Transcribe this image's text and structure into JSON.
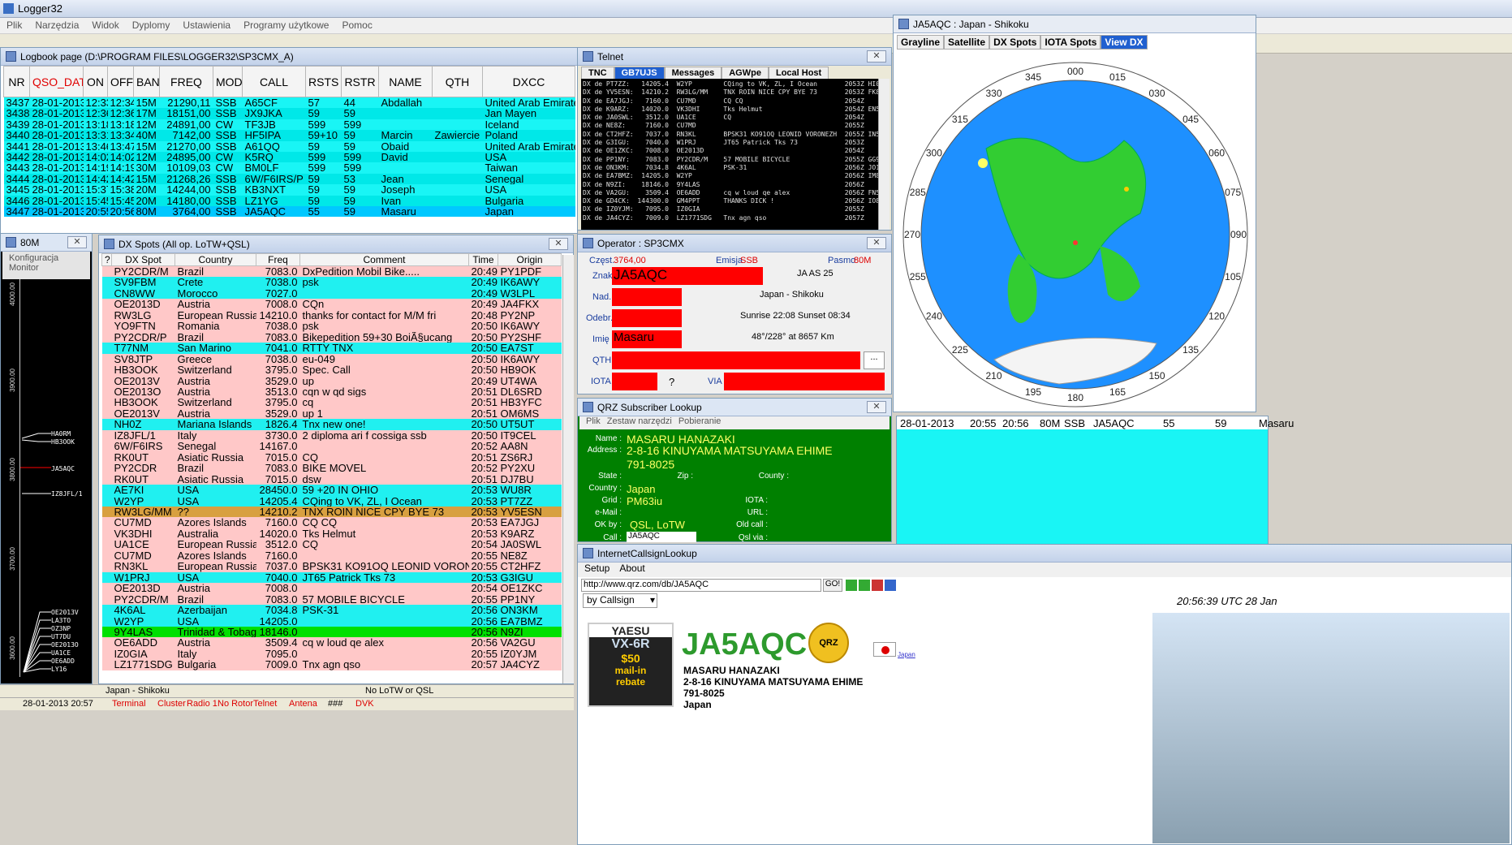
{
  "app": {
    "title": "Logger32"
  },
  "menu": [
    "Plik",
    "Narzędzia",
    "Widok",
    "Dyplomy",
    "Ustawienia",
    "Programy użytkowe",
    "Pomoc"
  ],
  "logbook": {
    "title": "Logbook page (D:\\PROGRAM FILES\\LOGGER32\\SP3CMX_A)",
    "columns": [
      "NR",
      "QSO_DATE",
      "ON",
      "OFF",
      "BAND",
      "FREQ",
      "MODE",
      "CALL",
      "RSTS",
      "RSTR",
      "NAME",
      "QTH",
      "DXCC"
    ],
    "rows": [
      [
        "3437",
        "28-01-2013",
        "12:33",
        "12:34",
        "15M",
        "21290,11",
        "SSB",
        "A65CF",
        "57",
        "44",
        "Abdallah",
        "",
        "United Arab Emirates"
      ],
      [
        "3438",
        "28-01-2013",
        "12:36",
        "12:36",
        "17M",
        "18151,00",
        "SSB",
        "JX9JKA",
        "59",
        "59",
        "",
        "",
        "Jan Mayen"
      ],
      [
        "3439",
        "28-01-2013",
        "13:18",
        "13:18",
        "12M",
        "24891,00",
        "CW",
        "TF3JB",
        "599",
        "599",
        "",
        "",
        "Iceland"
      ],
      [
        "3440",
        "28-01-2013",
        "13:31",
        "13:34",
        "40M",
        "7142,00",
        "SSB",
        "HF5IPA",
        "59+10",
        "59",
        "Marcin",
        "Zawiercie",
        "Poland"
      ],
      [
        "3441",
        "28-01-2013",
        "13:46",
        "13:47",
        "15M",
        "21270,00",
        "SSB",
        "A61QQ",
        "59",
        "59",
        "Obaid",
        "",
        "United Arab Emirates"
      ],
      [
        "3442",
        "28-01-2013",
        "14:02",
        "14:02",
        "12M",
        "24895,00",
        "CW",
        "K5RQ",
        "599",
        "599",
        "David",
        "",
        "USA"
      ],
      [
        "3443",
        "28-01-2013",
        "14:19",
        "14:19",
        "30M",
        "10109,03",
        "CW",
        "BM0LF",
        "599",
        "599",
        "",
        "",
        "Taiwan"
      ],
      [
        "3444",
        "28-01-2013",
        "14:42",
        "14:42",
        "15M",
        "21268,26",
        "SSB",
        "6W/F6IRS/P",
        "59",
        "53",
        "Jean",
        "",
        "Senegal"
      ],
      [
        "3445",
        "28-01-2013",
        "15:37",
        "15:38",
        "20M",
        "14244,00",
        "SSB",
        "KB3NXT",
        "59",
        "59",
        "Joseph",
        "",
        "USA"
      ],
      [
        "3446",
        "28-01-2013",
        "15:45",
        "15:45",
        "20M",
        "14180,00",
        "SSB",
        "LZ1YG",
        "59",
        "59",
        "Ivan",
        "",
        "Bulgaria"
      ],
      [
        "3447",
        "28-01-2013",
        "20:55",
        "20:56",
        "80M",
        "3764,00",
        "SSB",
        "JA5AQC",
        "55",
        "59",
        "Masaru",
        "",
        "Japan"
      ]
    ]
  },
  "bandmap": {
    "title": "80M",
    "menu": [
      "Konfiguracja",
      "Monitor"
    ],
    "ticks": [
      "4000.00",
      "3900.00",
      "3800.00",
      "3700.00",
      "3600.00"
    ],
    "labels": [
      "HA0RM",
      "HB3OOK",
      "JA5AQC",
      "IZ8JFL/1",
      "OE2013V",
      "LA3TO",
      "OZ3NP",
      "UT7DU",
      "OE2013O",
      "UA1CE",
      "OE6ADD",
      "LY16"
    ]
  },
  "dxspots": {
    "title": "DX Spots (All op. LoTW+QSL)",
    "columns": [
      "?",
      "DX Spot",
      "Country",
      "Freq",
      "Comment",
      "Time",
      "Origin"
    ],
    "rows": [
      {
        "c": "pk",
        "v": [
          "",
          "PY2CDR/M",
          "Brazil",
          "7083.0",
          "DxPedition Mobil Bike.....",
          "20:49",
          "PY1PDF"
        ]
      },
      {
        "c": "cy",
        "v": [
          "",
          "SV9FBM",
          "Crete",
          "7038.0",
          "psk",
          "20:49",
          "IK6AWY"
        ]
      },
      {
        "c": "cy",
        "v": [
          "",
          "CN8WW",
          "Morocco",
          "7027.0",
          "",
          "20:49",
          "W3LPL"
        ]
      },
      {
        "c": "pk",
        "v": [
          "",
          "OE2013D",
          "Austria",
          "7008.0",
          "CQn",
          "20:49",
          "JA4FKX"
        ]
      },
      {
        "c": "pk",
        "v": [
          "",
          "RW3LG",
          "European Russia",
          "14210.0",
          "thanks for contact for M/M fri",
          "20:48",
          "PY2NP"
        ]
      },
      {
        "c": "pk",
        "v": [
          "",
          "YO9FTN",
          "Romania",
          "7038.0",
          "psk",
          "20:50",
          "IK6AWY"
        ]
      },
      {
        "c": "pk",
        "v": [
          "",
          "PY2CDR/P",
          "Brazil",
          "7083.0",
          "Bikepedition 59+30 BoiÃ§ucang",
          "20:50",
          "PY2SHF"
        ]
      },
      {
        "c": "cy",
        "v": [
          "",
          "T77NM",
          "San Marino",
          "7041.0",
          "RTTY TNX",
          "20:50",
          "EA7ST"
        ]
      },
      {
        "c": "pk",
        "v": [
          "",
          "SV8JTP",
          "Greece",
          "7038.0",
          "eu-049",
          "20:50",
          "IK6AWY"
        ]
      },
      {
        "c": "pk",
        "v": [
          "",
          "HB3OOK",
          "Switzerland",
          "3795.0",
          "Spec. Call",
          "20:50",
          "HB9OK"
        ]
      },
      {
        "c": "pk",
        "v": [
          "",
          "OE2013V",
          "Austria",
          "3529.0",
          "up",
          "20:49",
          "UT4WA"
        ]
      },
      {
        "c": "pk",
        "v": [
          "",
          "OE2013O",
          "Austria",
          "3513.0",
          "cqn w qd sigs",
          "20:51",
          "DL6SRD"
        ]
      },
      {
        "c": "pk",
        "v": [
          "",
          "HB3OOK",
          "Switzerland",
          "3795.0",
          "cq",
          "20:51",
          "HB3YFC"
        ]
      },
      {
        "c": "pk",
        "v": [
          "",
          "OE2013V",
          "Austria",
          "3529.0",
          "up 1",
          "20:51",
          "OM6MS"
        ]
      },
      {
        "c": "cy",
        "v": [
          "",
          "NH0Z",
          "Mariana Islands",
          "1826.4",
          "Tnx new one!",
          "20:50",
          "UT5UT"
        ]
      },
      {
        "c": "pk",
        "v": [
          "",
          "IZ8JFL/1",
          "Italy",
          "3730.0",
          "2 diploma ari f cossiga ssb",
          "20:50",
          "IT9CEL"
        ]
      },
      {
        "c": "pk",
        "v": [
          "",
          "6W/F6IRS",
          "Senegal",
          "14167.0",
          "",
          "20:52",
          "AA8N"
        ]
      },
      {
        "c": "pk",
        "v": [
          "",
          "RK0UT",
          "Asiatic Russia",
          "7015.0",
          "CQ",
          "20:51",
          "ZS6RJ"
        ]
      },
      {
        "c": "pk",
        "v": [
          "",
          "PY2CDR",
          "Brazil",
          "7083.0",
          "BIKE MOVEL",
          "20:52",
          "PY2XU"
        ]
      },
      {
        "c": "pk",
        "v": [
          "",
          "RK0UT",
          "Asiatic Russia",
          "7015.0",
          "dsw",
          "20:51",
          "DJ7BU"
        ]
      },
      {
        "c": "cy",
        "v": [
          "",
          "AE7KI",
          "USA",
          "28450.0",
          "59 +20 IN OHIO",
          "20:53",
          "WU8R"
        ]
      },
      {
        "c": "cy",
        "v": [
          "",
          "W2YP",
          "USA",
          "14205.4",
          "CQing to VK, ZL, I Ocean",
          "20:53",
          "PT7ZZ"
        ]
      },
      {
        "c": "or",
        "v": [
          "",
          "RW3LG/MM",
          "??",
          "14210.2",
          "TNX ROIN NICE CPY BYE 73",
          "20:53",
          "YV5ESN"
        ]
      },
      {
        "c": "pk",
        "v": [
          "",
          "CU7MD",
          "Azores Islands",
          "7160.0",
          "CQ CQ",
          "20:53",
          "EA7JGJ"
        ]
      },
      {
        "c": "pk",
        "v": [
          "",
          "VK3DHI",
          "Australia",
          "14020.0",
          "Tks Helmut",
          "20:53",
          "K9ARZ"
        ]
      },
      {
        "c": "pk",
        "v": [
          "",
          "UA1CE",
          "European Russia",
          "3512.0",
          "CQ",
          "20:54",
          "JA0SWL"
        ]
      },
      {
        "c": "pk",
        "v": [
          "",
          "CU7MD",
          "Azores Islands",
          "7160.0",
          "",
          "20:55",
          "NE8Z"
        ]
      },
      {
        "c": "pk",
        "v": [
          "",
          "RN3KL",
          "European Russia",
          "7037.0",
          "BPSK31 KO91OQ LEONID VORONEZH",
          "20:55",
          "CT2HFZ"
        ]
      },
      {
        "c": "cy",
        "v": [
          "",
          "W1PRJ",
          "USA",
          "7040.0",
          "JT65 Patrick Tks 73",
          "20:53",
          "G3IGU"
        ]
      },
      {
        "c": "pk",
        "v": [
          "",
          "OE2013D",
          "Austria",
          "7008.0",
          "",
          "20:54",
          "OE1ZKC"
        ]
      },
      {
        "c": "pk",
        "v": [
          "",
          "PY2CDR/M",
          "Brazil",
          "7083.0",
          "57 MOBILE BICYCLE",
          "20:55",
          "PP1NY"
        ]
      },
      {
        "c": "cy",
        "v": [
          "",
          "4K6AL",
          "Azerbaijan",
          "7034.8",
          "PSK-31",
          "20:56",
          "ON3KM"
        ]
      },
      {
        "c": "cy",
        "v": [
          "",
          "W2YP",
          "USA",
          "14205.0",
          "",
          "20:56",
          "EA7BMZ"
        ]
      },
      {
        "c": "gr",
        "v": [
          "",
          "9Y4LAS",
          "Trinidad & Tobago",
          "18146.0",
          "",
          "20:56",
          "N9ZI"
        ]
      },
      {
        "c": "pk",
        "v": [
          "",
          "OE6ADD",
          "Austria",
          "3509.4",
          "cq w loud qe alex",
          "20:56",
          "VA2GU"
        ]
      },
      {
        "c": "pk",
        "v": [
          "",
          "IZ0GIA",
          "Italy",
          "7095.0",
          "",
          "20:55",
          "IZ0YJM"
        ]
      },
      {
        "c": "pk",
        "v": [
          "",
          "LZ1771SDG",
          "Bulgaria",
          "7009.0",
          "Tnx agn qso",
          "20:57",
          "JA4CYZ"
        ]
      }
    ]
  },
  "telnet": {
    "title": "Telnet",
    "tabs": [
      "TNC",
      "GB7UJS",
      "Messages",
      "AGWpe",
      "Local Host"
    ],
    "lines": [
      "DX de PT7ZZ:   14205.4  W2YP        CQing to VK, ZL, I Ocean       2053Z HI06",
      "DX de YV5ESN:  14210.2  RW3LG/MM    TNX ROIN NICE CPY BYE 73       2053Z FK80",
      "DX de EA7JGJ:   7160.0  CU7MD       CQ CQ                          2054Z",
      "DX de K9ARZ:   14020.0  VK3DHI      Tks Helmut                     2054Z EN51",
      "DX de JA0SWL:   3512.0  UA1CE       CQ                             2054Z",
      "DX de NE8Z:     7160.0  CU7MD                                      2055Z",
      "DX de CT2HFZ:   7037.0  RN3KL       BPSK31 KO91OQ LEONID VORONEZH  2055Z IN51",
      "DX de G3IGU:    7040.0  W1PRJ       JT65 Patrick Tks 73            2053Z",
      "DX de OE1ZKC:   7008.0  OE2013D                                    2054Z",
      "DX de PP1NY:    7083.0  PY2CDR/M    57 MOBILE BICYCLE              2055Z GG99",
      "DX de ON3KM:    7034.8  4K6AL       PSK-31                         2056Z JO11",
      "DX de EA7BMZ:  14205.0  W2YP                                       2056Z IM86",
      "DX de N9ZI:    18146.0  9Y4LAS                                     2056Z",
      "DX de VA2GU:    3509.4  OE6ADD      cq w loud qe alex              2056Z FN58",
      "DX de GD4CK:  144300.0  GM4PPT      THANKS DICK !                  2056Z IO82",
      "DX de IZ0YJM:   7095.0  IZ0GIA                                     2055Z",
      "DX de JA4CYZ:   7009.0  LZ1771SDG   Tnx agn qso                    2057Z"
    ]
  },
  "operator": {
    "title": "Operator : SP3CMX",
    "czest_label": "Częst.",
    "czest": "3764,00",
    "emisja_label": "Emisja",
    "emisja": "SSB",
    "pasmo_label": "Pasmo",
    "pasmo": "80M",
    "znak_label": "Znak",
    "znak": "JA5AQC",
    "zone": "JA  AS  25",
    "nad_label": "Nad.",
    "country": "Japan - Shikoku",
    "odebr_label": "Odebr.",
    "sun": "Sunrise 22:08 Sunset 08:34",
    "imie_label": "Imię",
    "imie": "Masaru",
    "bearing": "48°/228° at  8657 Km",
    "qth_label": "QTH",
    "iota_label": "IOTA",
    "iota_q": "?",
    "via_label": "VIA",
    "more": "..."
  },
  "qrz": {
    "title": "QRZ Subscriber Lookup",
    "menu": [
      "Plik",
      "Zestaw narzędzi",
      "Pobieranie"
    ],
    "name_label": "Name :",
    "name": "MASARU HANAZAKI",
    "address_label": "Address :",
    "address1": "2-8-16 KINUYAMA MATSUYAMA EHIME",
    "address2": "791-8025",
    "state_label": "State :",
    "zip_label": "Zip :",
    "county_label": "County :",
    "country_label": "Country :",
    "country": "Japan",
    "grid_label": "Grid :",
    "grid": "PM63iu",
    "iota_label": "IOTA :",
    "email_label": "e-Mail :",
    "url_label": "URL :",
    "okby_label": "OK by :",
    "okby": "QSL, LoTW",
    "oldcall_label": "Old call :",
    "call_label": "Call :",
    "call": "JA5AQC",
    "qslvia_label": "Qsl via :"
  },
  "dxmap": {
    "title": "JA5AQC : Japan - Shikoku",
    "tabs": [
      "Grayline",
      "Satellite",
      "DX Spots",
      "IOTA Spots",
      "View DX"
    ],
    "bearings": [
      "000",
      "015",
      "030",
      "045",
      "060",
      "075",
      "090",
      "105",
      "120",
      "135",
      "150",
      "165",
      "180",
      "195",
      "210",
      "225",
      "240",
      "255",
      "270",
      "285",
      "300",
      "315",
      "330",
      "345"
    ]
  },
  "logmini": {
    "row": [
      "28-01-2013",
      "20:55",
      "20:56",
      "80M",
      "SSB",
      "JA5AQC",
      "55",
      "59",
      "Masaru"
    ]
  },
  "inet": {
    "title": "InternetCallsignLookup",
    "menu": [
      "Setup",
      "About"
    ],
    "url": "http://www.qrz.com/db/JA5AQC",
    "go": "GO!",
    "search_mode": "by Callsign",
    "time": "20:56:39 UTC 28 Jan",
    "callsign": "JA5AQC",
    "name": "MASARU HANAZAKI",
    "addr1": "2-8-16 KINUYAMA MATSUYAMA EHIME",
    "addr2": "791-8025",
    "country": "Japan",
    "flag_label": "Japan",
    "ad_brand": "YAESU",
    "ad_model": "VX-6R",
    "ad_promo1": "$50",
    "ad_promo2": "mail-in",
    "ad_promo3": "rebate",
    "badge": "QRZ"
  },
  "status": {
    "country": "Japan - Shikoku",
    "lotw": "No LoTW or QSL",
    "datetime": "28-01-2013  20:57",
    "items": [
      "Terminal",
      "Cluster",
      "Radio 1",
      "No Rotor",
      "Telnet",
      "Antena",
      "###",
      "DVK"
    ]
  }
}
